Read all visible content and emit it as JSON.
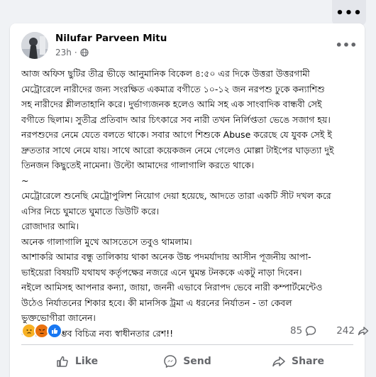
{
  "topbar": {
    "more_icon": "more-horizontal-icon",
    "more_label": "•••"
  },
  "post": {
    "author": "Nilufar Parveen Mitu",
    "timestamp": "23h",
    "separator": "·",
    "audience_icon": "globe-icon",
    "more_label": "•••",
    "lines": [
      "আজ অফিস ছুটির তীব্র ভীড়ে আনুমানিক বিকেল ৪:৫০ এর দিকে উত্তরা উত্তরগামী",
      "মেট্রোরেলে নারীদের জন্য সংরক্ষিত একমাত্র বগীতে ১০-১২ জন নরপশু ঢুকে কন্যাশিশু",
      "সহ নারীদের শ্লীলতাহানি করে। দুর্ভাগ্যজনক হলেও আমি সহ এক সাংবাদিক বান্ধবী সেই",
      "বগীতে ছিলাম। সুতীব্র প্রতিবাদ আর চিৎকারে সব নারী তখন নির্লিপ্ততা ভেঙে সজাগ হয়।",
      "নরপশুদের নেমে যেতে বলতে থাকে। সবার আগে শিশুকে Abuse করেছে যে যুবক সেই ই",
      "দ্রুততার সাথে নেমে যায়। সাথে আরো কয়েকজন নেমে গেলেও মোল্লা টাইপের ঘাড়ত্যা দুই",
      "তিনজন কিছুতেই নামেনা। উল্টো আমাদের গালাগালি করতে থাকে।",
      "~",
      "মেট্রোরেলে শুনেছি মেট্রোপুলিশ নিয়োগ দেয়া হয়েছে, আদতে তারা একটি সীট দখল করে",
      "এসির নিচে ঘুমাতে ঘুমাতে ডিউটি করে।",
      "রোজাদার আমি।",
      "অনেক গালাগালি মুখে আসতেসে তবুও থামলাম।",
      "আশাকরি আমার বন্ধু তালিকায় থাকা অনেক উচ্চ পদমর্যাদায় আসীন পূজনীয় আপা-",
      "ভাইয়েরা বিষয়টি যথাযথ কর্তৃপক্ষের নজরে এনে ঘুমন্ত টনককে একটু নাড়া দিবেন।",
      "নইলে আমিসহ আপনার কন্যা, জায়া, জননী এভাবে নিরাপদ ভেবে নারী কম্পার্টমেন্টেও",
      "উঠেও নির্যাতনের শিকার হবে। কী মানসিক ট্রমা এ ধরনের নির্যাতন - তা কেবল",
      "ভুক্তভোগীরা জানেন।",
      "এ এক অসম্ভব বিচিত্র নব্য স্বাধীনতার রেশ!!"
    ],
    "reaction_icons": [
      "sad-reaction-icon",
      "angry-reaction-icon",
      "like-reaction-icon"
    ],
    "comment_count": "85",
    "comment_icon": "comment-icon",
    "share_count": "242",
    "share_icon": "share-icon"
  },
  "actions": {
    "like_label": "Like",
    "send_label": "Send",
    "share_label": "Share"
  },
  "colors": {
    "page_bg": "#f0f2f5",
    "card_bg": "#ffffff",
    "text_primary": "#050505",
    "text_secondary": "#65676b",
    "like_blue": "#1877f2",
    "angry_orange": "#e9710f",
    "sad_yellow": "#f7b125"
  }
}
